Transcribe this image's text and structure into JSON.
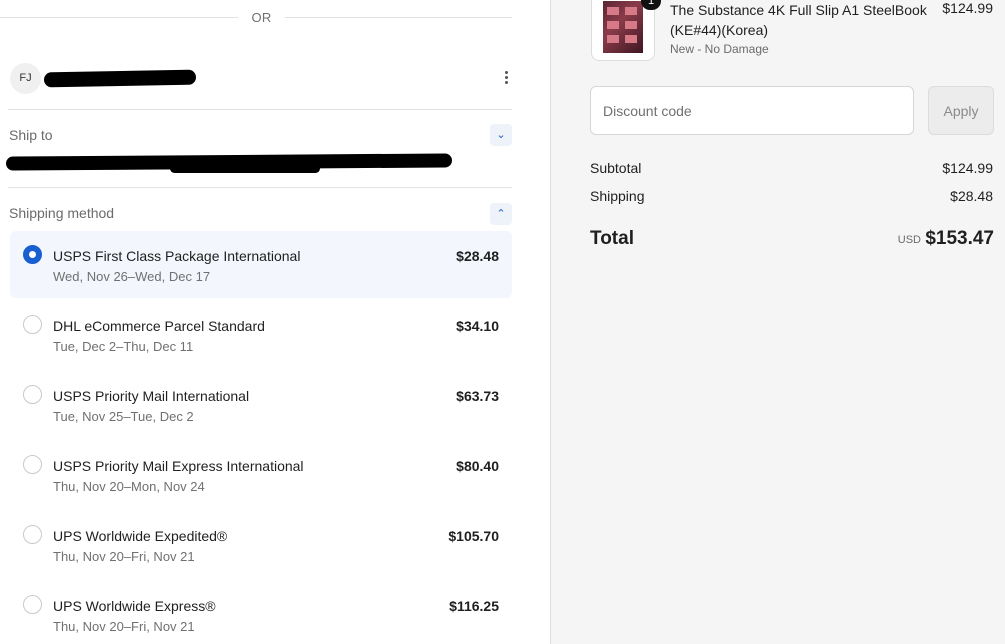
{
  "divider": {
    "text": "OR"
  },
  "account": {
    "initials": "FJ"
  },
  "ship_to": {
    "label": "Ship to"
  },
  "shipping": {
    "label": "Shipping method",
    "options": [
      {
        "name": "USPS First Class Package International",
        "eta": "Wed, Nov 26–Wed, Dec 17",
        "price": "$28.48",
        "selected": true
      },
      {
        "name": "DHL eCommerce Parcel Standard",
        "eta": "Tue, Dec 2–Thu, Dec 11",
        "price": "$34.10",
        "selected": false
      },
      {
        "name": "USPS Priority Mail International",
        "eta": "Tue, Nov 25–Tue, Dec 2",
        "price": "$63.73",
        "selected": false
      },
      {
        "name": "USPS Priority Mail Express International",
        "eta": "Thu, Nov 20–Mon, Nov 24",
        "price": "$80.40",
        "selected": false
      },
      {
        "name": "UPS Worldwide Expedited®",
        "eta": "Thu, Nov 20–Fri, Nov 21",
        "price": "$105.70",
        "selected": false
      },
      {
        "name": "UPS Worldwide Express®",
        "eta": "Thu, Nov 20–Fri, Nov 21",
        "price": "$116.25",
        "selected": false
      }
    ]
  },
  "product": {
    "title": "The Substance 4K Full Slip A1 SteelBook (KE#44)(Korea)",
    "variant": "New - No Damage",
    "price": "$124.99",
    "quantity": "1"
  },
  "discount": {
    "placeholder": "Discount code",
    "apply_label": "Apply"
  },
  "summary": {
    "subtotal_label": "Subtotal",
    "subtotal_value": "$124.99",
    "shipping_label": "Shipping",
    "shipping_value": "$28.48",
    "total_label": "Total",
    "currency": "USD",
    "total_value": "$153.47"
  },
  "colors": {
    "accent": "#1a5fd0",
    "selected_bg": "#f3f6fd",
    "sidebar_bg": "#f5f5f5"
  }
}
